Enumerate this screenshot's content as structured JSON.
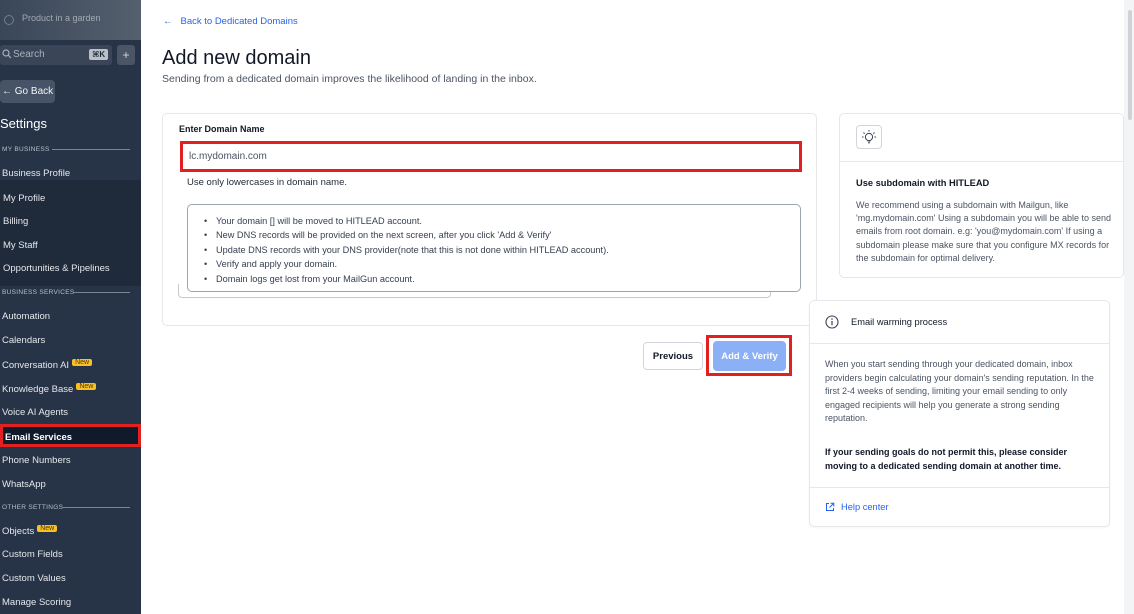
{
  "sidebar": {
    "brand": "Product in a garden",
    "search_placeholder": "Search",
    "search_shortcut": "⌘K",
    "plus": "+",
    "go_back": "← Go Back",
    "heading": "Settings",
    "sections": {
      "my_business": "MY BUSINESS",
      "business_services": "BUSINESS SERVICES",
      "other_settings": "OTHER SETTINGS"
    },
    "items": {
      "business_profile": "Business Profile",
      "my_profile": "My Profile",
      "billing": "Billing",
      "my_staff": "My Staff",
      "opportunities": "Opportunities & Pipelines",
      "automation": "Automation",
      "calendars": "Calendars",
      "conversation_ai": "Conversation AI",
      "knowledge_base": "Knowledge Base",
      "voice_ai": "Voice AI Agents",
      "email_services": "Email Services",
      "phone_numbers": "Phone Numbers",
      "whatsapp": "WhatsApp",
      "objects": "Objects",
      "custom_fields": "Custom Fields",
      "custom_values": "Custom Values",
      "manage_scoring": "Manage Scoring"
    },
    "badge_new": "New"
  },
  "main": {
    "back_link": "Back to Dedicated Domains",
    "title": "Add new domain",
    "subtitle": "Sending from a dedicated domain improves the likelihood of landing in the inbox.",
    "field_label": "Enter Domain Name",
    "field_placeholder": "lc.mydomain.com",
    "hint": "Use only lowercases in domain name.",
    "info_items": [
      "Your domain [] will be moved to HITLEAD account.",
      "New DNS records will be provided on the next screen, after you click 'Add & Verify'",
      "Update DNS records with your DNS provider(note that this is not done within HITLEAD account).",
      "Verify and apply your domain.",
      "Domain logs get lost from your MailGun account."
    ],
    "btn_previous": "Previous",
    "btn_verify": "Add & Verify"
  },
  "tip_card": {
    "title": "Use subdomain with HITLEAD",
    "body": "We recommend using a subdomain with Mailgun, like 'mg.mydomain.com' Using a subdomain you will be able to send emails from root domain. e.g: 'you@mydomain.com' If using a subdomain please make sure that you configure MX records for the subdomain for optimal delivery."
  },
  "warm_card": {
    "title": "Email warming process",
    "body": "When you start sending through your dedicated domain, inbox providers begin calculating your domain's sending reputation. In the first 2-4 weeks of sending, limiting your email sending to only engaged recipients will help you generate a strong sending reputation.",
    "body_bold": "If your sending goals do not permit this, please consider moving to a dedicated sending domain at another time.",
    "help_link": "Help center"
  }
}
